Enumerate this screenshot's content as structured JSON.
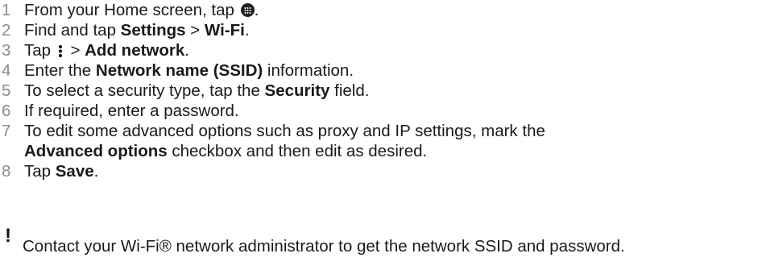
{
  "steps": [
    {
      "num": "1",
      "parts": {
        "a": "From your Home screen, tap ",
        "b": "."
      }
    },
    {
      "num": "2",
      "parts": {
        "a": "Find and tap ",
        "b": "Settings",
        "c": " > ",
        "d": "Wi-Fi",
        "e": "."
      }
    },
    {
      "num": "3",
      "parts": {
        "a": "Tap ",
        "b": " > ",
        "c": "Add network",
        "d": "."
      }
    },
    {
      "num": "4",
      "parts": {
        "a": "Enter the ",
        "b": "Network name (SSID)",
        "c": " information."
      }
    },
    {
      "num": "5",
      "parts": {
        "a": "To select a security type, tap the ",
        "b": "Security",
        "c": " field."
      }
    },
    {
      "num": "6",
      "parts": {
        "a": "If required, enter a password."
      }
    },
    {
      "num": "7",
      "parts": {
        "a": "To edit some advanced options such as proxy and IP settings, mark the",
        "b": "Advanced options",
        "c": " checkbox and then edit as desired."
      }
    },
    {
      "num": "8",
      "parts": {
        "a": "Tap ",
        "b": "Save",
        "c": "."
      }
    }
  ],
  "note": {
    "icon": "exclamation-icon",
    "text": "Contact your Wi-Fi® network administrator to get the network SSID and password."
  },
  "icons": {
    "step1": "apps-grid-icon",
    "step3": "more-options-icon"
  },
  "colors": {
    "step_number": "#8c8c8c",
    "text": "#1a1a1a"
  }
}
